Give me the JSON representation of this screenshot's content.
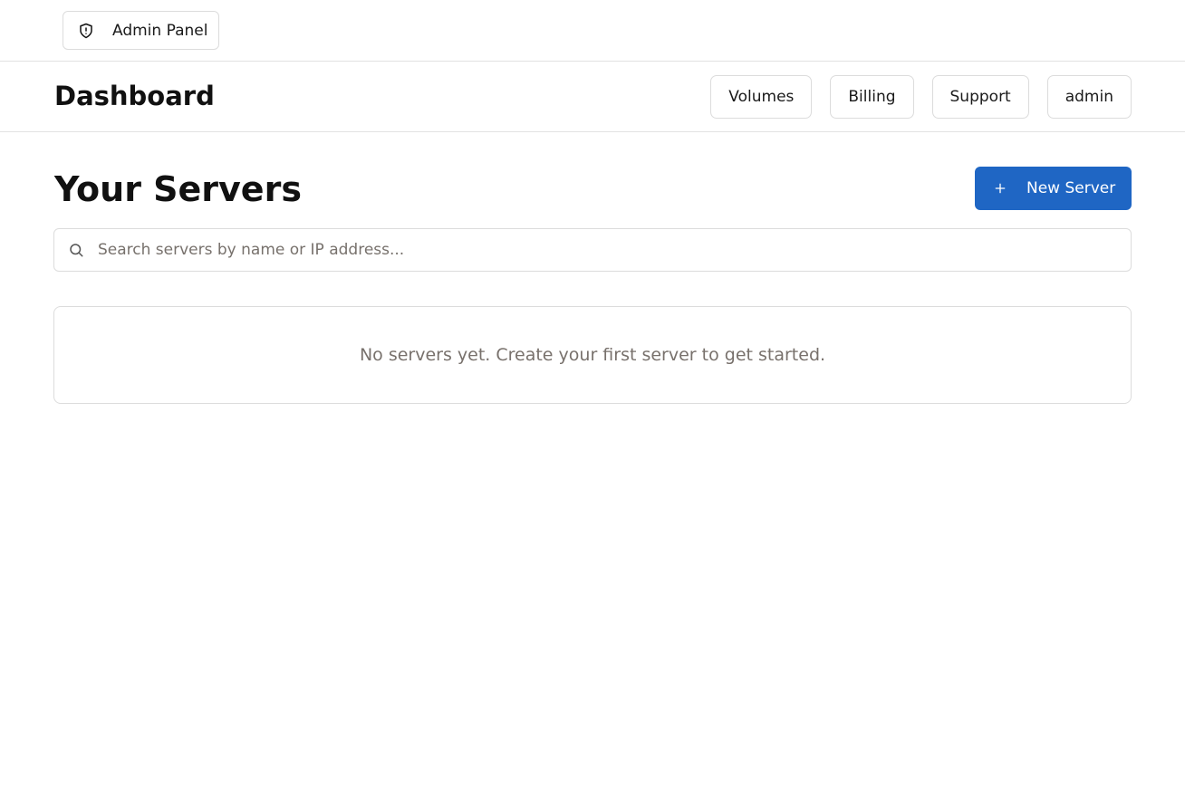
{
  "admin_bar": {
    "label": "Admin Panel",
    "icon": "shield-alert-icon"
  },
  "header": {
    "title": "Dashboard",
    "nav": [
      {
        "label": "Volumes"
      },
      {
        "label": "Billing"
      },
      {
        "label": "Support"
      },
      {
        "label": "admin"
      }
    ]
  },
  "main": {
    "heading": "Your Servers",
    "new_server_label": "New Server",
    "new_server_icon": "plus-icon",
    "search": {
      "placeholder": "Search servers by name or IP address...",
      "value": "",
      "icon": "search-icon"
    },
    "empty_message": "No servers yet. Create your first server to get started."
  },
  "colors": {
    "primary": "#1f66c4",
    "border": "#dcdcdc",
    "muted_text": "#78716c"
  }
}
